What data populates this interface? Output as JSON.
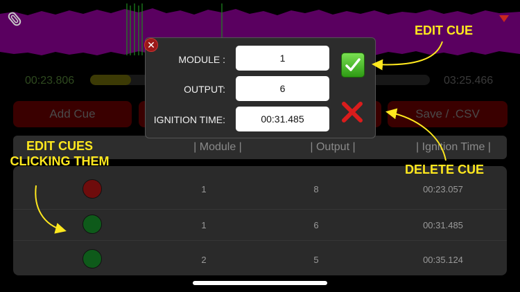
{
  "player": {
    "elapsed": "00:23.806",
    "duration": "03:25.466",
    "progress_fraction": 0.12
  },
  "toolbar": {
    "add_cue_label": "Add Cue",
    "save_label": "Save / .CSV"
  },
  "table": {
    "columns": [
      "| Module |",
      "| Output |",
      "| Ignition Time |"
    ],
    "rows": [
      {
        "status_color": "#6e0c0c",
        "module": "1",
        "output": "8",
        "ignition_time": "00:23.057"
      },
      {
        "status_color": "#0e5a1a",
        "module": "1",
        "output": "6",
        "ignition_time": "00:31.485"
      },
      {
        "status_color": "#0e5a1a",
        "module": "2",
        "output": "5",
        "ignition_time": "00:35.124"
      }
    ]
  },
  "dialog": {
    "module_label": "MODULE :",
    "module_value": "1",
    "output_label": "OUTPUT:",
    "output_value": "6",
    "ignition_label": "IGNITION TIME:",
    "ignition_value": "00:31.485",
    "close_icon": "close-icon",
    "confirm_icon": "check-icon",
    "delete_icon": "x-icon"
  },
  "annotations": {
    "edit_cue": "EDIT CUE",
    "delete_cue": "DELETE CUE",
    "edit_cues_line1": "EDIT CUES",
    "edit_cues_line2": "CLICKING THEM"
  },
  "colors": {
    "waveform": "#5a0060",
    "accent_annotation": "#ffe81e",
    "button_red": "#3a0000"
  }
}
